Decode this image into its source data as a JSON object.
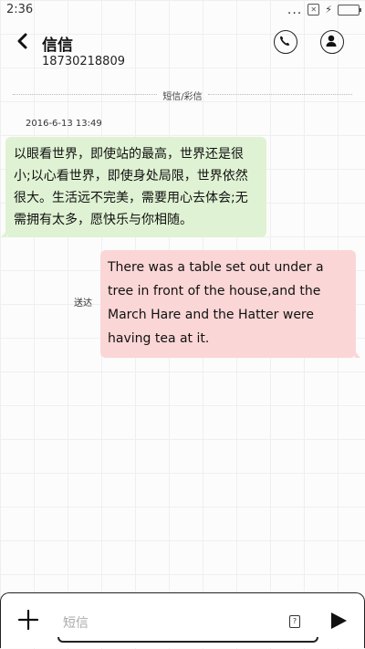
{
  "status_bar": {
    "time": "2:36",
    "dots": "...",
    "sim_icon": "sim-card-icon",
    "charging_icon": "charging-bolt-icon",
    "battery_icon": "battery-icon"
  },
  "header": {
    "back_icon": "back-arrow-icon",
    "contact_name": "信信",
    "phone_number": "18730218809",
    "call_icon": "phone-icon",
    "profile_icon": "person-icon"
  },
  "conversation": {
    "channel_label": "短信/彩信",
    "timestamp": "2016-6-13 13:49",
    "messages": [
      {
        "direction": "incoming",
        "text": "以眼看世界，即使站的最高，世界还是很小;以心看世界，即使身处局限，世界依然很大。生活远不完美，需要用心去体会;无需拥有太多，愿快乐与你相随。",
        "color": "#dff2d3"
      },
      {
        "direction": "outgoing",
        "text": "There was a table set out under a tree in front of the house,and the March Hare and the Hatter were having tea at it.",
        "status": "送达",
        "color": "#fbd6d6"
      }
    ]
  },
  "composer": {
    "add_icon": "plus-icon",
    "placeholder": "短信",
    "sim_selector_icon": "sim-card-icon",
    "send_icon": "send-icon"
  }
}
